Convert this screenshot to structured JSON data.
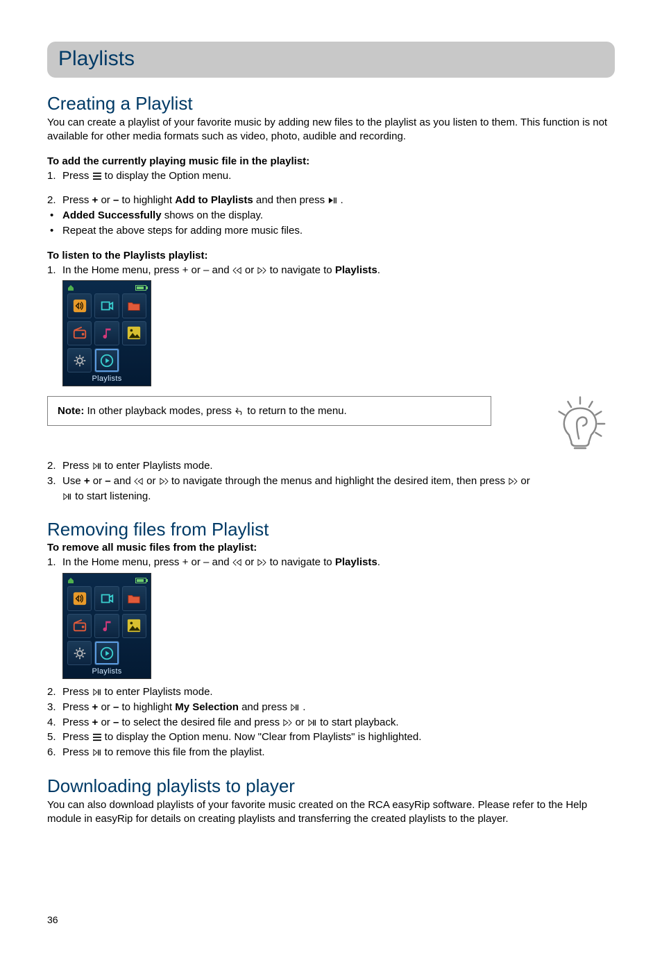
{
  "page": {
    "number": "36",
    "title": "Playlists"
  },
  "sec1": {
    "heading": "Creating a Playlist",
    "intro": "You can create a playlist of your favorite music by adding new files to the playlist as you listen to them. This function is not available for other media formats such as video, photo, audible and recording.",
    "sub1": "To add the currently playing music file in the playlist:",
    "s1_step1_a": "Press ",
    "s1_step1_b": " to display the Option menu.",
    "s1_step2_a": "Press ",
    "s1_step2_plus": "+",
    "s1_step2_or1": " or ",
    "s1_step2_minus": "–",
    "s1_step2_b": " to highlight ",
    "s1_step2_bold": "Add to Playlists",
    "s1_step2_c": " and then press ",
    "s1_step2_d": " .",
    "s1_b1_bold": "Added Successfully",
    "s1_b1_rest": " shows on the display.",
    "s1_b2": "Repeat the above steps for adding more music files.",
    "sub2": "To listen to the Playlists playlist:",
    "s2_step1_a": "In the Home menu, press + or – and  ",
    "s2_step1_or": "  or  ",
    "s2_step1_b": "  to navigate to ",
    "s2_step1_bold": "Playlists",
    "s2_step1_c": ".",
    "note_label": "Note:",
    "note_a": " In other playback modes, press ",
    "note_b": " to return to the menu.",
    "s2_step2_a": "Press ",
    "s2_step2_b": " to enter Playlists mode.",
    "s2_step3_a": "Use  ",
    "s2_step3_plus": "+",
    "s2_step3_or1": " or ",
    "s2_step3_minus": "–",
    "s2_step3_b": " and  ",
    "s2_step3_or2": "  or  ",
    "s2_step3_c": "  to navigate through the menus and highlight the desired item, then press  ",
    "s2_step3_d": " or ",
    "s2_step3_e": " to start listening."
  },
  "sec2": {
    "heading": "Removing files from Playlist",
    "sub1": "To remove all music files from the playlist:",
    "step1_a": "In the Home menu, press + or – and  ",
    "step1_or": "  or  ",
    "step1_b": " to navigate to ",
    "step1_bold": "Playlists",
    "step1_c": ".",
    "step2_a": "Press ",
    "step2_b": " to enter Playlists mode.",
    "step3_a": "Press ",
    "step3_plus": "+",
    "step3_or": " or ",
    "step3_minus": "–",
    "step3_b": " to highlight ",
    "step3_bold": "My Selection",
    "step3_c": " and press ",
    "step3_d": " .",
    "step4_a": "Press ",
    "step4_plus": "+",
    "step4_or1": " or ",
    "step4_minus": "–",
    "step4_b": " to select the desired file and press  ",
    "step4_or2": " or ",
    "step4_c": " to start playback.",
    "step5_a": "Press ",
    "step5_b": " to display the Option menu. Now \"Clear from Playlists\" is highlighted.",
    "step6_a": "Press ",
    "step6_b": "  to remove this file from the playlist."
  },
  "sec3": {
    "heading": "Downloading playlists to player",
    "body": "You can also download playlists of your favorite music created on the RCA easyRip software. Please refer to the Help module in easyRip for details on creating playlists and transferring the created playlists to the player."
  },
  "device": {
    "label": "Playlists"
  }
}
